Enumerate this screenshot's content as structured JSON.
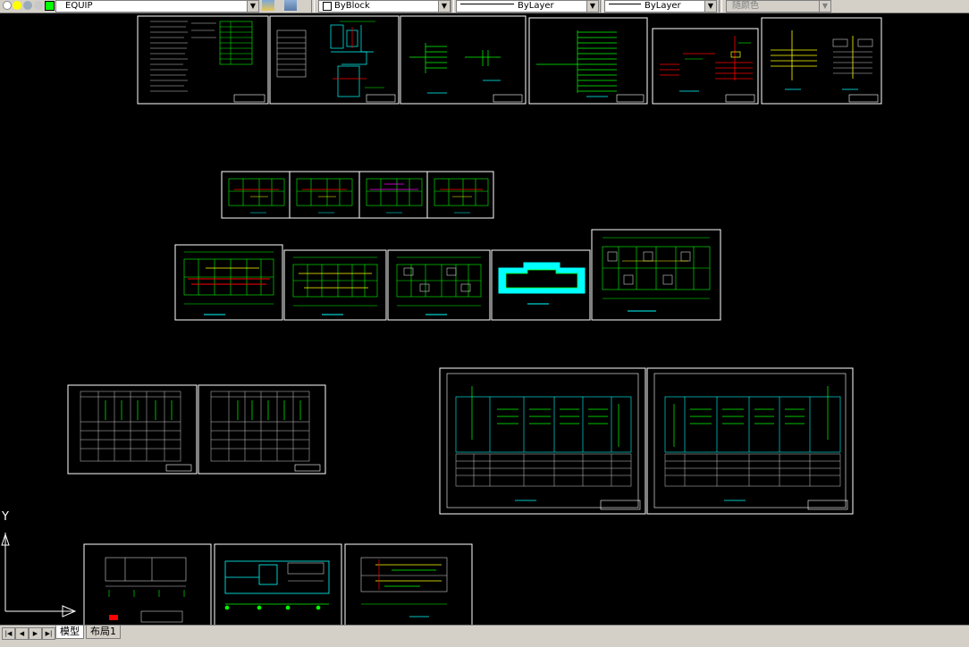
{
  "toolbar": {
    "layer_name": "EQUIP",
    "block_label": "ByBlock",
    "linetype_label": "ByLayer",
    "lineweight_label": "ByLayer",
    "color_label": "随颜色"
  },
  "tabs": [
    {
      "label": "模型",
      "active": true
    },
    {
      "label": "布局1",
      "active": false
    }
  ],
  "ucs": {
    "y_label": "Y"
  },
  "colors": {
    "sheet_border": "#ffffff",
    "line_green": "#00ff00",
    "line_cyan": "#00ffff",
    "line_red": "#ff0000",
    "line_yellow": "#ffff00",
    "line_magenta": "#ff00ff"
  }
}
